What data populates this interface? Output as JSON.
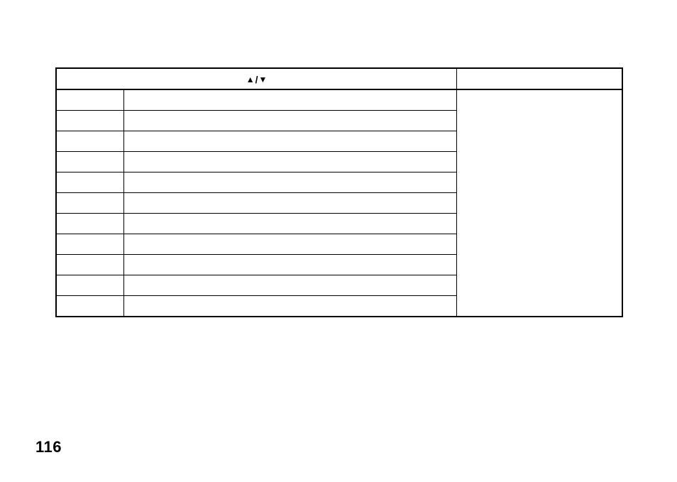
{
  "page_number": "116",
  "table": {
    "header": {
      "col12_label": "",
      "col12_icons": {
        "up": "▲",
        "sep": "/",
        "down": "▼"
      },
      "col3_label": ""
    },
    "rows": [
      {
        "c1": "",
        "c2": "",
        "c3_merge_start": true,
        "c3": ""
      },
      {
        "c1": "",
        "c2": ""
      },
      {
        "c1": "",
        "c2": ""
      },
      {
        "c1": "",
        "c2": ""
      },
      {
        "c1": "",
        "c2": ""
      },
      {
        "c1": "",
        "c2": ""
      },
      {
        "c1": "",
        "c2": ""
      },
      {
        "c1": "",
        "c2": ""
      },
      {
        "c1": "",
        "c2": ""
      },
      {
        "c1": "",
        "c2": ""
      },
      {
        "c1": "",
        "c2": ""
      }
    ]
  }
}
